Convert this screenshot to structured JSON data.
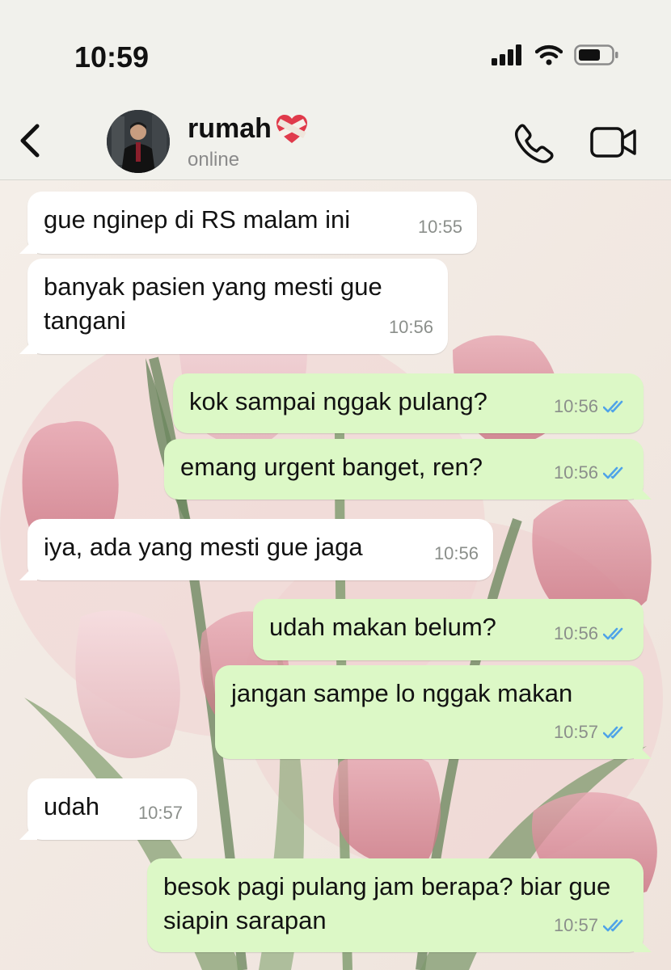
{
  "status_bar": {
    "time": "10:59"
  },
  "header": {
    "contact_name": "rumah",
    "presence": "online"
  },
  "messages": [
    {
      "dir": "in",
      "text": "gue nginep di RS malam ini",
      "time": "10:55"
    },
    {
      "dir": "in",
      "text": "banyak pasien yang mesti gue tangani",
      "time": "10:56"
    },
    {
      "dir": "out",
      "text": "kok sampai nggak pulang?",
      "time": "10:56",
      "status": "read"
    },
    {
      "dir": "out",
      "text": "emang urgent banget, ren?",
      "time": "10:56",
      "status": "read"
    },
    {
      "dir": "in",
      "text": "iya, ada yang mesti gue jaga",
      "time": "10:56"
    },
    {
      "dir": "out",
      "text": "udah makan belum?",
      "time": "10:56",
      "status": "read"
    },
    {
      "dir": "out",
      "text": "jangan sampe lo nggak makan",
      "time": "10:57",
      "status": "read"
    },
    {
      "dir": "in",
      "text": "udah",
      "time": "10:57"
    },
    {
      "dir": "out",
      "text": "besok pagi pulang jam berapa? biar gue siapin sarapan",
      "time": "10:57",
      "status": "read"
    }
  ],
  "colors": {
    "incoming_bubble": "#ffffff",
    "outgoing_bubble": "#dcf8c6",
    "read_ticks": "#4fa3e8"
  }
}
